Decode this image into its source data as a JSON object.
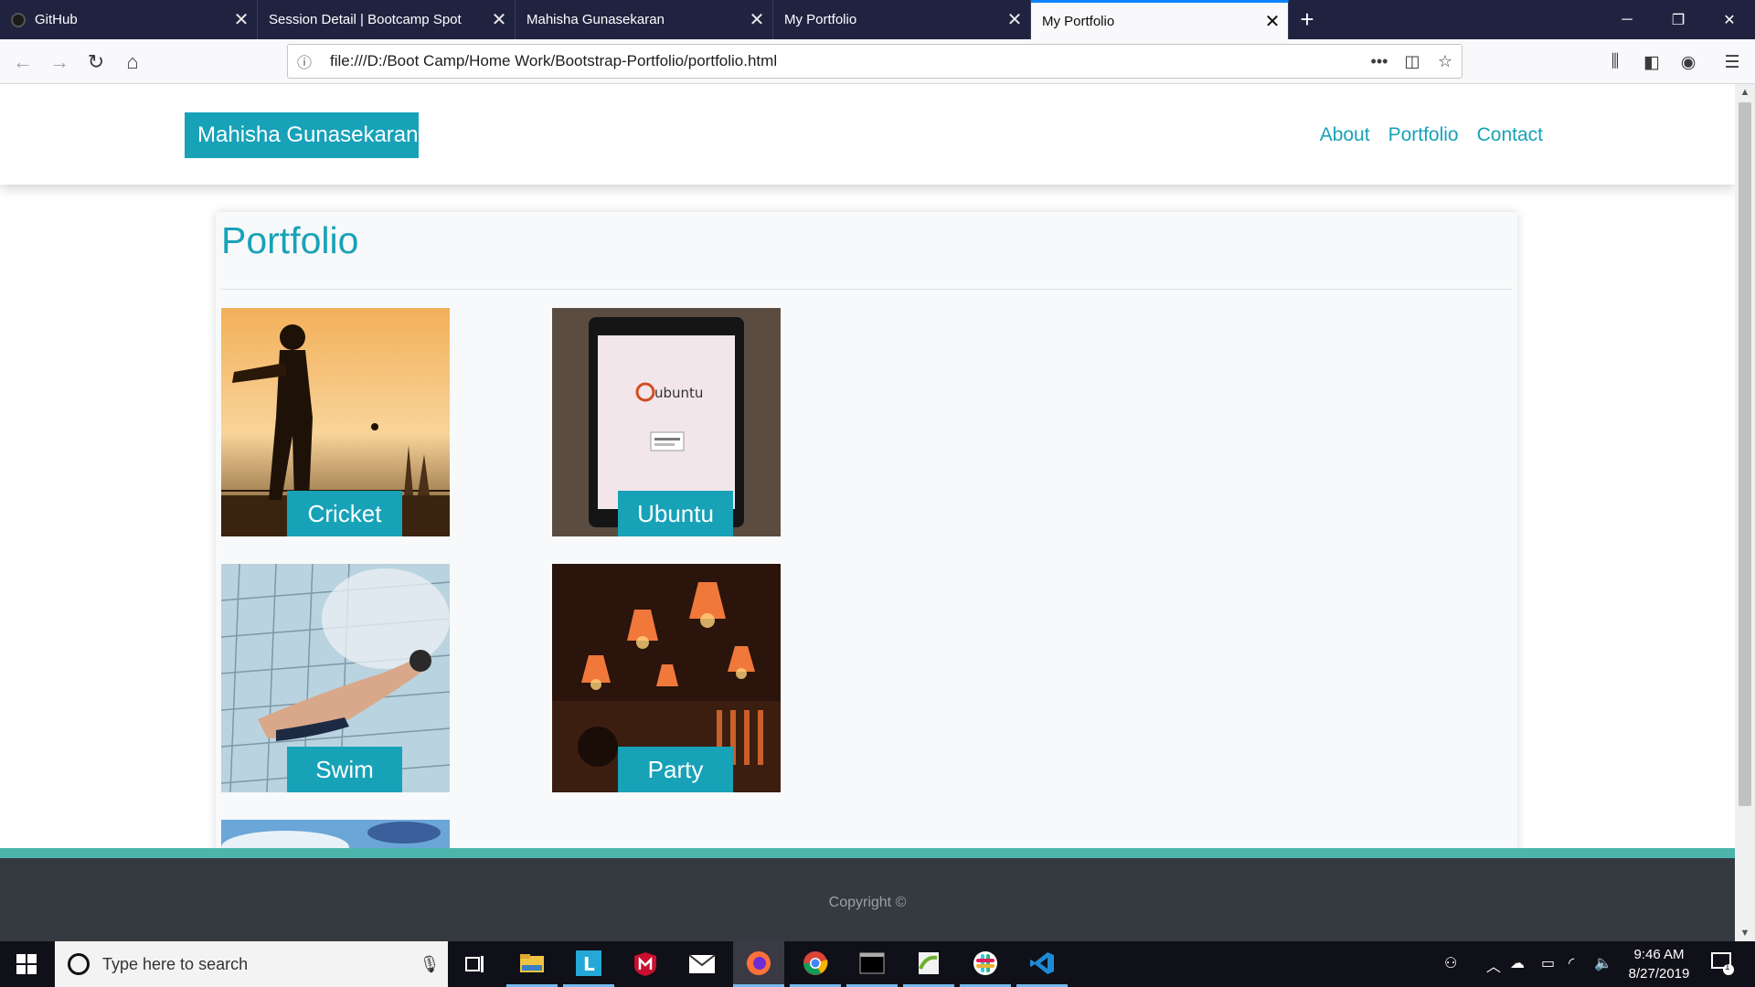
{
  "browser": {
    "tabs": [
      {
        "title": "GitHub",
        "active": false
      },
      {
        "title": "Session Detail | Bootcamp Spot",
        "active": false
      },
      {
        "title": "Mahisha Gunasekaran",
        "active": false
      },
      {
        "title": "My Portfolio",
        "active": false
      },
      {
        "title": "My Portfolio",
        "active": true
      }
    ],
    "new_tab_label": "+",
    "url": "file:///D:/Boot Camp/Home Work/Bootstrap-Portfolio/portfolio.html"
  },
  "site": {
    "brand": "Mahisha Gunasekaran",
    "nav": [
      {
        "label": "About"
      },
      {
        "label": "Portfolio"
      },
      {
        "label": "Contact"
      }
    ],
    "page_title": "Portfolio",
    "items": [
      {
        "caption": "Cricket",
        "image": "cricket-photo"
      },
      {
        "caption": "Ubuntu",
        "image": "ubuntu-tablet-photo"
      },
      {
        "caption": "Swim",
        "image": "swimmer-photo"
      },
      {
        "caption": "Party",
        "image": "party-lamps-photo"
      }
    ],
    "footer": {
      "copyright": "Copyright ©"
    },
    "accent_color": "#17a2b8"
  },
  "taskbar": {
    "search_placeholder": "Type here to search",
    "time": "9:46 AM",
    "date": "8/27/2019",
    "notification_count": "1"
  }
}
